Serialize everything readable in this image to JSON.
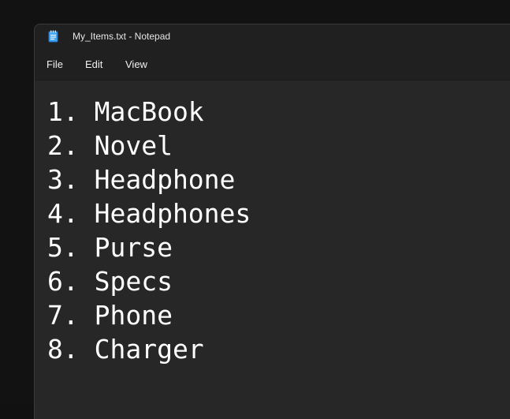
{
  "window": {
    "title": "My_Items.txt - Notepad",
    "app_icon": "notepad-icon"
  },
  "menu": {
    "file": "File",
    "edit": "Edit",
    "view": "View"
  },
  "document": {
    "lines": [
      "1. MacBook",
      "2. Novel",
      "3. Headphone",
      "4. Headphones",
      "5. Purse",
      "6. Specs",
      "7. Phone",
      "8. Charger"
    ]
  },
  "colors": {
    "background": "#121213",
    "window": "#202020",
    "editor": "#272727",
    "text": "#ffffff",
    "icon_accent": "#3aa0ff"
  }
}
